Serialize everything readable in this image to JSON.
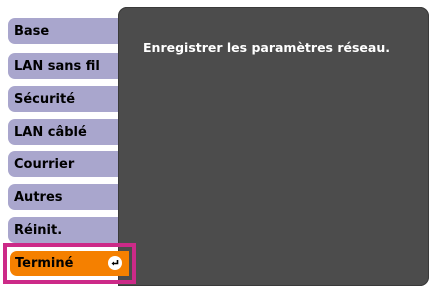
{
  "tabs": [
    {
      "id": "base",
      "label": "Base"
    },
    {
      "id": "wlan",
      "label": "LAN sans fil"
    },
    {
      "id": "security",
      "label": "Sécurité"
    },
    {
      "id": "wired",
      "label": "LAN câblé"
    },
    {
      "id": "mail",
      "label": "Courrier"
    },
    {
      "id": "others",
      "label": "Autres"
    },
    {
      "id": "reset",
      "label": "Réinit."
    }
  ],
  "done_tab": {
    "label": "Terminé",
    "icon": "enter-icon"
  },
  "content": {
    "message": "Enregistrer les paramètres réseau."
  },
  "colors": {
    "tab_inactive": "#a9a6cd",
    "tab_active": "#f58000",
    "panel_background": "#4c4c4c",
    "highlight_frame": "#cc2a88"
  }
}
